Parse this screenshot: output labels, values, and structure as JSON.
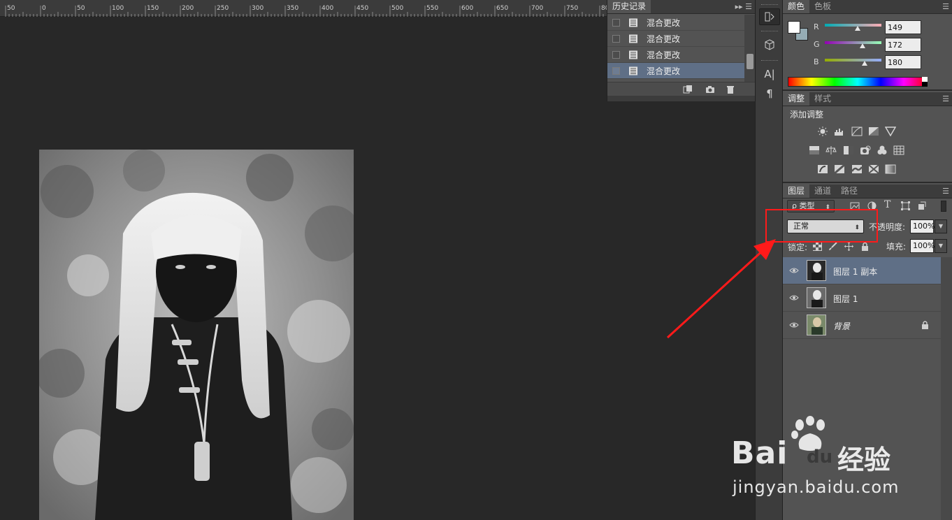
{
  "ruler": {
    "ticks": [
      "50",
      "0",
      "50",
      "100",
      "150",
      "200",
      "250",
      "300",
      "350",
      "400",
      "450",
      "500",
      "550",
      "600",
      "650",
      "700",
      "750",
      "80"
    ]
  },
  "history": {
    "tab": "历史记录",
    "menu": "▸▸ ☰",
    "items": [
      {
        "label": "混合更改",
        "active": false
      },
      {
        "label": "混合更改",
        "active": false
      },
      {
        "label": "混合更改",
        "active": false
      },
      {
        "label": "混合更改",
        "active": true
      }
    ]
  },
  "color": {
    "tabs": [
      "颜色",
      "色板"
    ],
    "menu": "☰",
    "foreground": "#ffffff",
    "background": "#95acb4",
    "channels": [
      {
        "letter": "R",
        "value": "149"
      },
      {
        "letter": "G",
        "value": "172"
      },
      {
        "letter": "B",
        "value": "180"
      }
    ]
  },
  "adjustments": {
    "tabs": [
      "调整",
      "样式"
    ],
    "menu": "☰",
    "title": "添加调整"
  },
  "layers": {
    "tabs": [
      "图层",
      "通道",
      "路径"
    ],
    "menu": "☰",
    "filter_label": "ρ 类型",
    "blend_mode": "正常",
    "opacity_label": "不透明度:",
    "opacity_value": "100%",
    "lock_label": "锁定:",
    "fill_label": "填充:",
    "fill_value": "100%",
    "items": [
      {
        "name": "图层 1 副本",
        "active": true,
        "italic": false,
        "locked": false
      },
      {
        "name": "图层 1",
        "active": false,
        "italic": false,
        "locked": false
      },
      {
        "name": "背景",
        "active": false,
        "italic": true,
        "locked": true
      }
    ]
  },
  "tool_strip": {
    "text_tool": "A|",
    "paragraph_tool": "¶"
  },
  "watermark": {
    "brand": "Bai",
    "brand_du": "du",
    "brand_cn": "经验",
    "url": "jingyan.baidu.com"
  },
  "colors": {
    "accent_selected": "#5f6f86",
    "annotation": "#ff1a1a"
  }
}
